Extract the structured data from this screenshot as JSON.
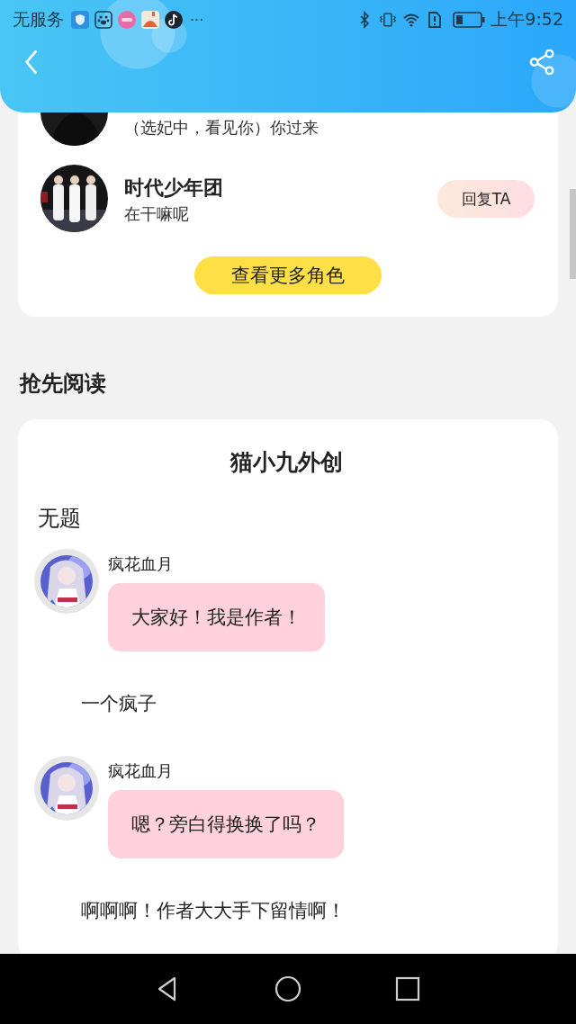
{
  "status_bar": {
    "carrier": "无服务",
    "more": "···",
    "time": "上午9:52"
  },
  "roles": {
    "items": [
      {
        "message": "（选妃中，看见你）你过来"
      },
      {
        "name": "时代少年团",
        "message": "在干嘛呢",
        "reply_button": "回复TA"
      }
    ],
    "more_button": "查看更多角色"
  },
  "section_title": "抢先阅读",
  "story": {
    "title": "猫小九外创",
    "chapter": "无题",
    "entries": [
      {
        "kind": "message",
        "speaker": "疯花血月",
        "text": "大家好！我是作者！"
      },
      {
        "kind": "narration",
        "text": "一个疯子"
      },
      {
        "kind": "message",
        "speaker": "疯花血月",
        "text": "嗯？旁白得换换了吗？"
      },
      {
        "kind": "narration",
        "text": "啊啊啊！作者大大手下留情啊！"
      }
    ]
  }
}
